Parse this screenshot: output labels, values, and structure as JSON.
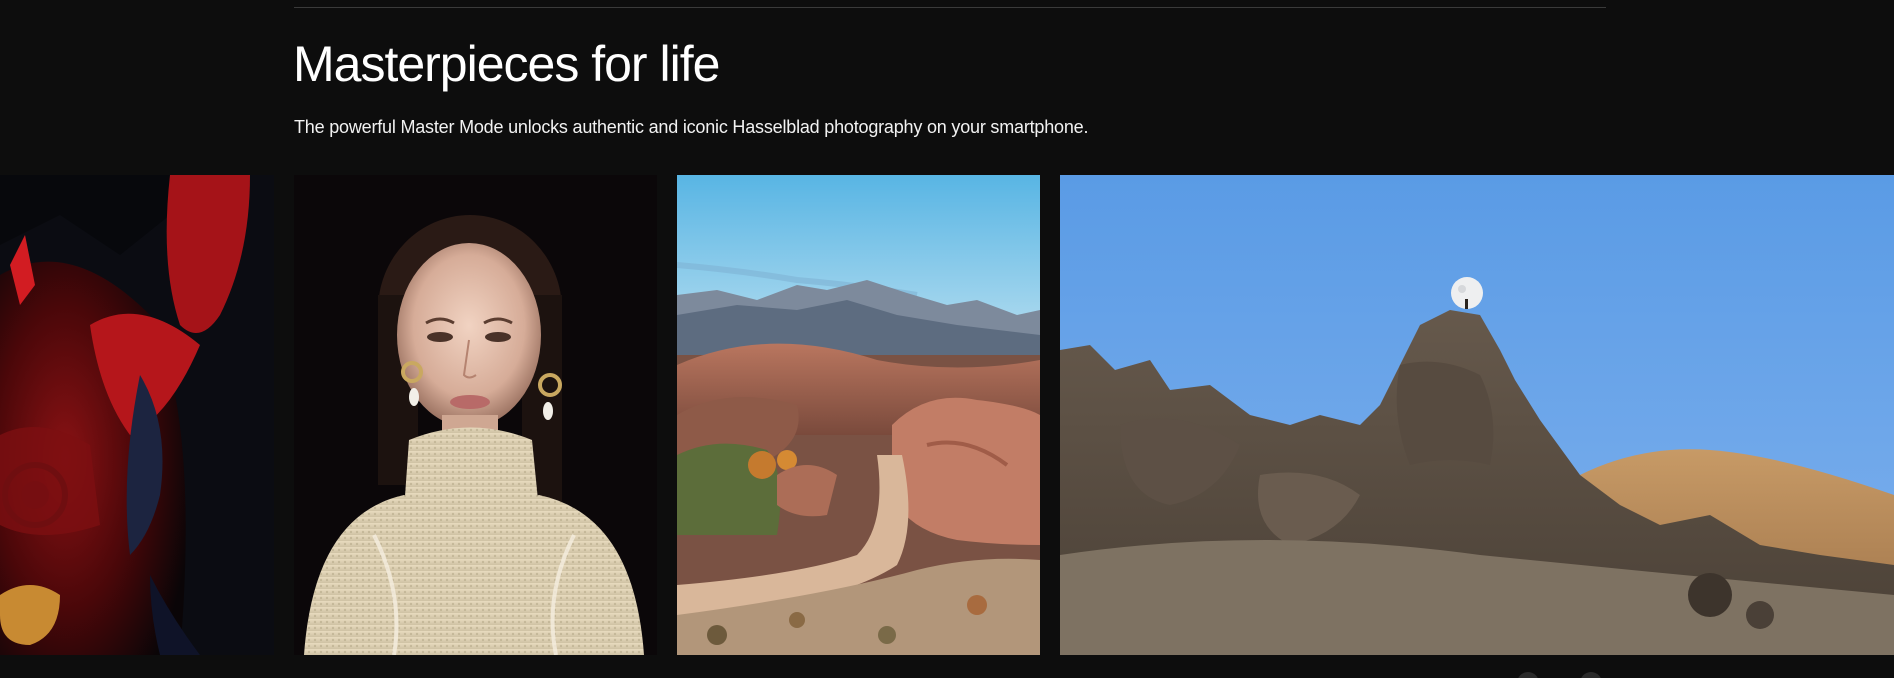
{
  "section": {
    "title": "Masterpieces for life",
    "subtitle": "The powerful Master Mode unlocks authentic and iconic Hasselblad photography on your smartphone."
  },
  "gallery": {
    "photos": [
      {
        "subject": "opera-costume-photo"
      },
      {
        "subject": "portrait-photo"
      },
      {
        "subject": "desert-road-photo"
      },
      {
        "subject": "moon-over-rocks-photo"
      }
    ]
  },
  "colors": {
    "background": "#0d0d0d",
    "text": "#ffffff",
    "divider": "#3a3a3a"
  }
}
